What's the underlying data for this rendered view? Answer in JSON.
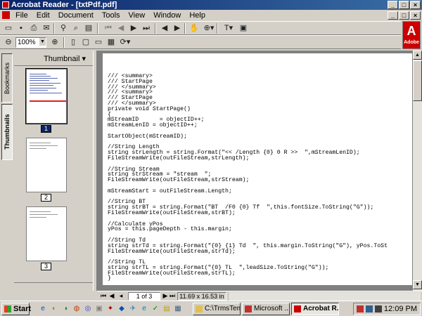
{
  "window": {
    "title": "Acrobat Reader - [txtPdf.pdf]",
    "controls": {
      "minimize": "_",
      "maximize": "□",
      "close": "×"
    }
  },
  "menu": [
    "File",
    "Edit",
    "Document",
    "Tools",
    "View",
    "Window",
    "Help"
  ],
  "toolbar": {
    "zoom_value": "100%",
    "icons": [
      "open-icon",
      "save-icon",
      "print-icon",
      "email-icon",
      "find-icon",
      "search-icon",
      "show-hide-navigation-icon",
      "first-page-icon",
      "previous-page-icon",
      "next-page-icon",
      "last-page-icon",
      "go-back-icon",
      "go-forward-icon",
      "hand-tool-icon",
      "zoom-tool-icon",
      "text-select-tool-icon",
      "snapshot-tool-icon",
      "zoom-out-icon",
      "zoom-in-icon",
      "actual-size-icon",
      "fit-page-icon",
      "fit-width-icon",
      "rotate-icon"
    ]
  },
  "brand": {
    "logo_text": "Adobe",
    "color": "#cc0000"
  },
  "side_tabs": {
    "bookmarks": "Bookmarks",
    "thumbnails": "Thumbnails"
  },
  "thumbnail_pane": {
    "header": "Thumbnail",
    "pages": [
      {
        "label": "1",
        "selected": true
      },
      {
        "label": "2",
        "selected": false
      },
      {
        "label": "3",
        "selected": false
      }
    ]
  },
  "document": {
    "lines": [
      "/// <summary>",
      "/// StartPage",
      "/// </summary>",
      "/// <summary>",
      "/// StartPage",
      "/// </summary>",
      "private void StartPage()",
      "{",
      "mStreamID      = objectID++;",
      "mStreamLenID = objectID++;",
      "",
      "StartObject(mStreamID);",
      "",
      "//String Length",
      "string strLength = string.Format(\"<< /Length {0} 0 R >>  \",mStreamLenID);",
      "FileStreamWrite(outFileStream,strLength);",
      "",
      "//String Stream",
      "string strStream = \"stream  \";",
      "FileStreamWrite(outFileStream,strStream);",
      "",
      "mStreamStart = outFileStream.Length;",
      "",
      "//String BT",
      "string strBT = string.Format(\"BT  /F0 {0} Tf  \",this.fontSize.ToString(\"G\"));",
      "FileStreamWrite(outFileStream,strBT);",
      "",
      "//Calculate yPos",
      "yPos = this.pageDepth - this.margin;",
      "",
      "//String Td",
      "string strTd = string.Format(\"{0} {1} Td  \", this.margin.ToString(\"G\"), yPos.ToSt",
      "FileStreamWrite(outFileStream,strTd);",
      "",
      "//String TL",
      "string strTL = string.Format(\"{0} TL  \",leadSize.ToString(\"G\"));",
      "FileStreamWrite(outFileStream,strTL);",
      "}"
    ]
  },
  "status_bar": {
    "page_indicator": "1 of 3",
    "page_size": "11.69 x 16.53 in"
  },
  "taskbar": {
    "start_label": "Start",
    "tasks": [
      {
        "label": "C:\\TrmsTemp",
        "active": false
      },
      {
        "label": "Microsoft ...",
        "active": false
      },
      {
        "label": "Acrobat R...",
        "active": true
      }
    ],
    "clock": "12:09 PM"
  }
}
